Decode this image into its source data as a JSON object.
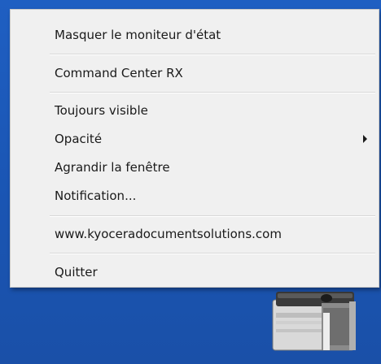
{
  "menu": {
    "items": [
      {
        "label": "Masquer le moniteur d'état"
      },
      {
        "label": "Command Center RX"
      },
      {
        "label": "Toujours visible"
      },
      {
        "label": "Opacité",
        "has_submenu": true
      },
      {
        "label": "Agrandir la fenêtre"
      },
      {
        "label": "Notification..."
      },
      {
        "label": "www.kyoceradocumentsolutions.com"
      },
      {
        "label": "Quitter"
      }
    ],
    "submenu_arrow_icon": "chevron-right-icon"
  },
  "desktop": {
    "background_color": "#1f5fc2",
    "tray_icon": "printer-icon"
  }
}
